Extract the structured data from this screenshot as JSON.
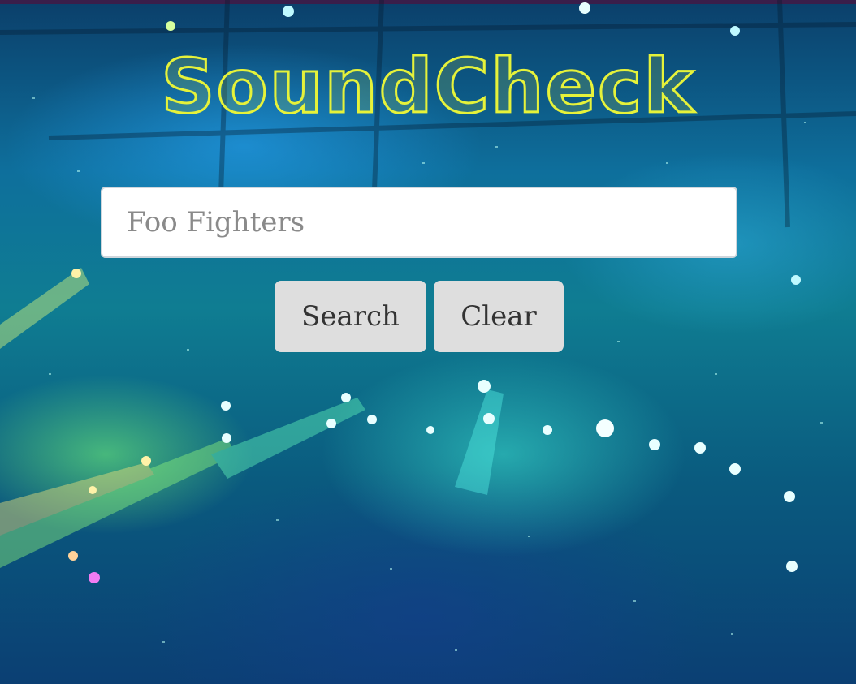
{
  "app": {
    "logo_text": "SoundCheck"
  },
  "search": {
    "placeholder": "Foo Fighters",
    "value": ""
  },
  "buttons": {
    "search_label": "Search",
    "clear_label": "Clear"
  },
  "colors": {
    "logo": "#e6f23a",
    "button_bg": "#dedede",
    "button_text": "#333333",
    "input_bg": "#ffffff",
    "placeholder_text": "#8a8a8a",
    "top_bar": "#3a1e4a"
  },
  "background": {
    "description": "concert-stage-with-teal-green-lights-and-confetti"
  }
}
